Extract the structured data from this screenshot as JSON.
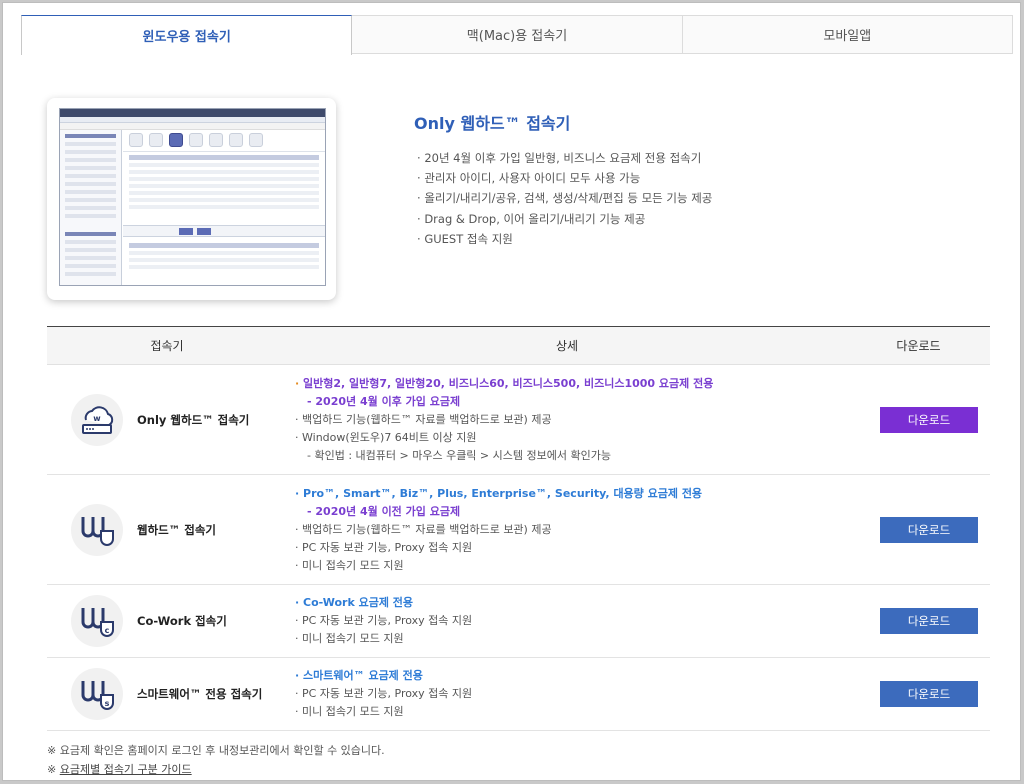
{
  "tabs": [
    {
      "label": "윈도우용 접속기",
      "active": true
    },
    {
      "label": "맥(Mac)용 접속기",
      "active": false
    },
    {
      "label": "모바일앱",
      "active": false
    }
  ],
  "intro": {
    "title": "Only 웹하드™ 접속기",
    "features": [
      "20년 4월 이후 가입 일반형, 비즈니스 요금제 전용 접속기",
      "관리자 아이디, 사용자 아이디 모두 사용 가능",
      "올리기/내리기/공유, 검색, 생성/삭제/편집 등 모든 기능 제공",
      "Drag & Drop, 이어 올리기/내리기 기능 제공",
      "GUEST 접속 지원"
    ]
  },
  "table": {
    "headers": [
      "접속기",
      "상세",
      "다운로드"
    ],
    "rows": [
      {
        "name": "Only 웹하드™ 접속기",
        "icon": "cloud-server-icon",
        "button": "다운로드",
        "button_color": "#7a2fd3",
        "details": [
          "일반형2, 일반형7, 일반형20, 비즈니스60, 비즈니스500, 비즈니스1000 요금제 전용",
          "- 2020년 4월 이후 가입 요금제",
          "백업하드 기능(웹하드™ 자료를 백업하드로 보관) 제공",
          "Window(윈도우)7 64비트 이상 지원",
          "- 확인법 : 내컴퓨터 > 마우스 우클릭 > 시스템 정보에서 확인가능"
        ]
      },
      {
        "name": "웹하드™ 접속기",
        "icon": "webhard-shield-icon",
        "button": "다운로드",
        "button_color": "#3c6bbd",
        "details": [
          "Pro™, Smart™, Biz™, Plus, Enterprise™, Security, 대용량 요금제 전용",
          "- 2020년 4월 이전 가입 요금제",
          "백업하드 기능(웹하드™ 자료를 백업하드로 보관) 제공",
          "PC 자동 보관 기능, Proxy 접속 지원",
          "미니 접속기 모드 지원"
        ]
      },
      {
        "name": "Co-Work 접속기",
        "icon": "cowork-shield-icon",
        "button": "다운로드",
        "button_color": "#3c6bbd",
        "details": [
          "Co-Work 요금제 전용",
          "PC 자동 보관 기능, Proxy 접속 지원",
          "미니 접속기 모드 지원"
        ]
      },
      {
        "name": "스마트웨어™ 전용 접속기",
        "icon": "smartware-shield-icon",
        "button": "다운로드",
        "button_color": "#3c6bbd",
        "details": [
          "스마트웨어™ 요금제 전용",
          "PC 자동 보관 기능, Proxy 접속 지원",
          "미니 접속기 모드 지원"
        ]
      }
    ]
  },
  "notes": {
    "line1": "※ 요금제 확인은 홈페이지 로그인 후 내정보관리에서 확인할 수 있습니다.",
    "line2_prefix": "※ ",
    "line2_link": "요금제별 접속기 구분 가이드"
  }
}
